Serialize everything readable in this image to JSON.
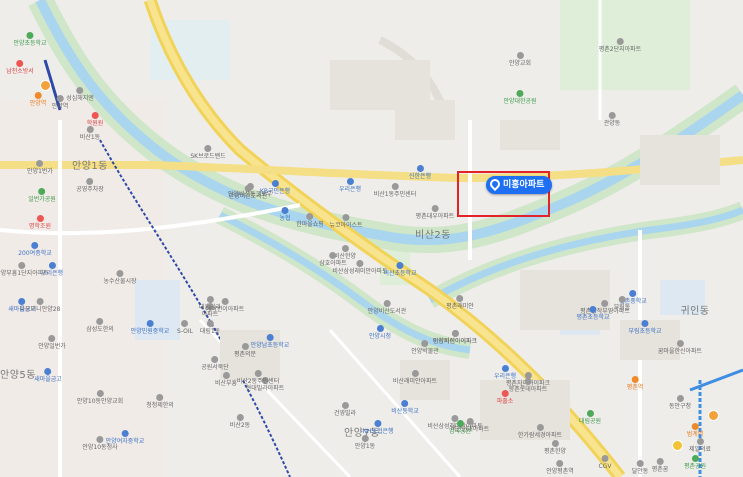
{
  "marker": {
    "label": "미홍아파트"
  },
  "labels": [
    {
      "t": "안양초등학교",
      "c": "green"
    },
    {
      "t": "남천소방서",
      "c": "red"
    },
    {
      "t": "안양역",
      "c": "orange"
    },
    {
      "t": "성심해지엔",
      "c": ""
    },
    {
      "t": "안양역",
      "c": ""
    },
    {
      "t": "학원원",
      "c": "red"
    },
    {
      "t": "안양1번가",
      "c": ""
    },
    {
      "t": "안양1동",
      "c": "big"
    },
    {
      "t": "일번가공원",
      "c": "green"
    },
    {
      "t": "공영주차장",
      "c": ""
    },
    {
      "t": "명학조원",
      "c": "red"
    },
    {
      "t": "우리은행",
      "c": "blue"
    },
    {
      "t": "농수산물시장",
      "c": ""
    },
    {
      "t": "200여중학교",
      "c": "blue"
    },
    {
      "t": "안양부흥1단지아파트",
      "c": ""
    },
    {
      "t": "새마을금고",
      "c": "blue"
    },
    {
      "t": "다오미니안양28",
      "c": ""
    },
    {
      "t": "삼성도한의",
      "c": ""
    },
    {
      "t": "안양일번가",
      "c": ""
    },
    {
      "t": "안양5동",
      "c": "big"
    },
    {
      "t": "새마을금고",
      "c": "blue"
    },
    {
      "t": "안양10동안양교회",
      "c": ""
    },
    {
      "t": "안양10동청사",
      "c": ""
    },
    {
      "t": "청청제한의",
      "c": ""
    },
    {
      "t": "안양민원중학교",
      "c": "blue"
    },
    {
      "t": "안양여자중학교",
      "c": "blue"
    },
    {
      "t": "대흥빌라",
      "c": ""
    },
    {
      "t": "아파트",
      "c": ""
    },
    {
      "t": "공원서북단",
      "c": ""
    },
    {
      "t": "에어컨이아파트",
      "c": ""
    },
    {
      "t": "SK브로드밴드",
      "c": ""
    },
    {
      "t": "안양비산도서관",
      "c": ""
    },
    {
      "t": "비산1동",
      "c": ""
    },
    {
      "t": "KB국민은행",
      "c": "blue"
    },
    {
      "t": "우리은행",
      "c": "blue"
    },
    {
      "t": "신한은행",
      "c": "blue"
    },
    {
      "t": "비산1동주민센터",
      "c": ""
    },
    {
      "t": "뉴코아이스트",
      "c": ""
    },
    {
      "t": "농협",
      "c": "blue"
    },
    {
      "t": "안양비산동크로우",
      "c": ""
    },
    {
      "t": "한마을쇼핑",
      "c": ""
    },
    {
      "t": "평촌대우아파트",
      "c": ""
    },
    {
      "t": "비산2동",
      "c": "big"
    },
    {
      "t": "비산한양",
      "c": ""
    },
    {
      "t": "삼호아파트",
      "c": ""
    },
    {
      "t": "안양비산도서관",
      "c": ""
    },
    {
      "t": "평촌래미안",
      "c": ""
    },
    {
      "t": "비산초등학교",
      "c": "blue"
    },
    {
      "t": "비산래미안아파트",
      "c": ""
    },
    {
      "t": "안양비산아이파크",
      "c": ""
    },
    {
      "t": "비산삼성래미안아파트",
      "c": ""
    },
    {
      "t": "비산2동",
      "c": ""
    },
    {
      "t": "대림1동",
      "c": ""
    },
    {
      "t": "안양남초등학교",
      "c": "blue"
    },
    {
      "t": "평촌의문",
      "c": ""
    },
    {
      "t": "비산삼성래미안아파트",
      "c": ""
    },
    {
      "t": "S-OIL",
      "c": ""
    },
    {
      "t": "비산부흥",
      "c": ""
    },
    {
      "t": "현대빌라아파트",
      "c": ""
    },
    {
      "t": "건영빌라",
      "c": ""
    },
    {
      "t": "안양7동",
      "c": "big"
    },
    {
      "t": "비산동학교",
      "c": "blue"
    },
    {
      "t": "대림공원",
      "c": "green"
    },
    {
      "t": "안양평촌역",
      "c": ""
    },
    {
      "t": "임곡공원",
      "c": "green"
    },
    {
      "t": "안양대한공원",
      "c": "green"
    },
    {
      "t": "평촌2단지아파트",
      "c": ""
    },
    {
      "t": "관양동",
      "c": ""
    },
    {
      "t": "신촌중학교",
      "c": "blue"
    },
    {
      "t": "귀인동",
      "c": "big"
    },
    {
      "t": "부림동",
      "c": ""
    },
    {
      "t": "평촌역",
      "c": "orange"
    },
    {
      "t": "범계역",
      "c": "orange"
    },
    {
      "t": "평촌공원",
      "c": "green"
    },
    {
      "t": "평촌꿈",
      "c": ""
    },
    {
      "t": "제일의료",
      "c": ""
    },
    {
      "t": "우리은행",
      "c": "blue"
    },
    {
      "t": "파출소",
      "c": "red"
    },
    {
      "t": "평촌자이아이파크",
      "c": ""
    },
    {
      "t": "향촌롯데아파트",
      "c": ""
    },
    {
      "t": "평촌공작부영아파트",
      "c": ""
    },
    {
      "t": "꿈마을한신아파트",
      "c": ""
    },
    {
      "t": "평촌초등학교",
      "c": "blue"
    },
    {
      "t": "부림초등학교",
      "c": "blue"
    },
    {
      "t": "한가람세경아파트",
      "c": ""
    },
    {
      "t": "평촌한양",
      "c": ""
    },
    {
      "t": "달안동",
      "c": ""
    },
    {
      "t": "CGV",
      "c": ""
    },
    {
      "t": "동안구청",
      "c": ""
    },
    {
      "t": "안양시청",
      "c": "blue"
    },
    {
      "t": "안양1동",
      "c": ""
    },
    {
      "t": "안양박물관",
      "c": ""
    },
    {
      "t": "비산2동주민센터",
      "c": ""
    },
    {
      "t": "NH농협은행",
      "c": "blue"
    },
    {
      "t": "비산현대아파트",
      "c": ""
    },
    {
      "t": "비산자이아이파크",
      "c": ""
    },
    {
      "t": "안양교회",
      "c": ""
    }
  ]
}
